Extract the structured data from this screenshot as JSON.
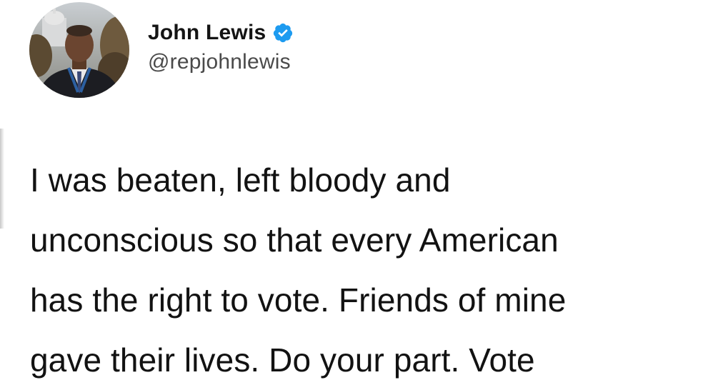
{
  "author": {
    "display_name": "John Lewis",
    "handle": "@repjohnlewis",
    "verified": true,
    "verified_icon": "verified-badge-icon",
    "verified_color": "#1d9bf0"
  },
  "tweet": {
    "lines": [
      "I was beaten, left bloody and",
      "unconscious so that every American",
      "has the right to vote. Friends of mine",
      "gave their lives. Do your part. Vote"
    ]
  }
}
